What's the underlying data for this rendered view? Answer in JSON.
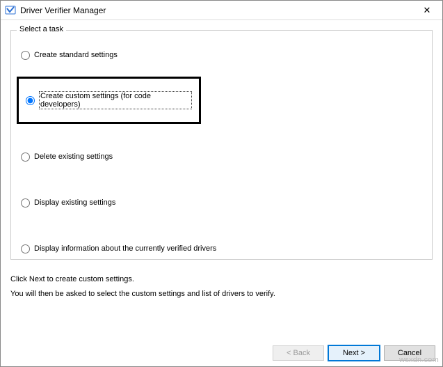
{
  "window": {
    "title": "Driver Verifier Manager",
    "close_label": "✕"
  },
  "group": {
    "title": "Select a task",
    "options": {
      "standard": "Create standard settings",
      "custom": "Create custom settings (for code developers)",
      "delete": "Delete existing settings",
      "display": "Display existing settings",
      "info": "Display information about the currently verified drivers"
    },
    "selected": "custom"
  },
  "instructions": {
    "line1": "Click Next to create custom settings.",
    "line2": "You will then be asked to select the custom settings and list of drivers to verify."
  },
  "buttons": {
    "back": "< Back",
    "next": "Next >",
    "cancel": "Cancel"
  },
  "watermark": "wsxdn.com"
}
